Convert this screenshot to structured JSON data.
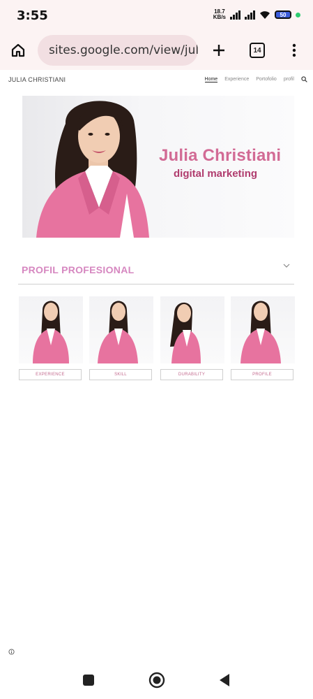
{
  "status_bar": {
    "time": "3:55",
    "net_speed_value": "18.7",
    "net_speed_unit": "KB/s",
    "battery": "50"
  },
  "browser": {
    "url": "sites.google.com/view/julia",
    "tab_count": "14"
  },
  "site": {
    "title": "JULIA CHRISTIANI",
    "nav": [
      "Home",
      "Experience",
      "Portofolio",
      "profil"
    ]
  },
  "hero": {
    "name": "Julia Christiani",
    "subtitle": "digital marketing"
  },
  "accordion": {
    "title": "PROFIL PROFESIONAL"
  },
  "gallery": {
    "buttons": [
      "EXPERIENCE",
      "SKILL",
      "DURABILITY",
      "PROFILE"
    ]
  },
  "colors": {
    "accent_pink": "#d26b95",
    "blazer_pink": "#e7739f",
    "heading_pink": "#d687c0"
  }
}
